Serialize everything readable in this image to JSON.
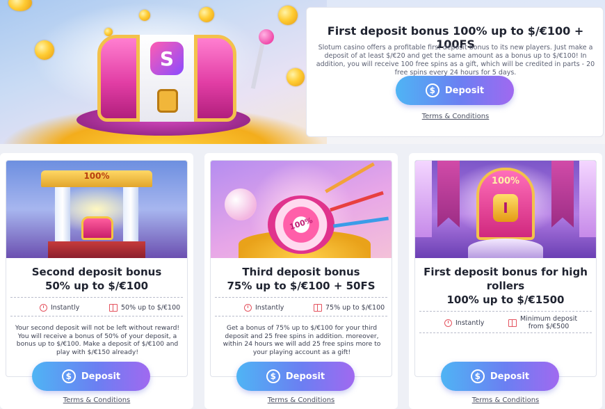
{
  "hero": {
    "title": "First deposit bonus 100% up to $/€100 + 100FS",
    "description": "Slotum casino offers a profitable first deposit bonus to its new players. Just make a deposit of at least $/€20 and get the same amount as a bonus up to $/€100! In addition, you will receive 100 free spins as a gift, which will be credited in parts - 20 free spins every 24 hours for 5 days.",
    "button_label": "Deposit",
    "terms_label": "Terms & Conditions"
  },
  "cards": [
    {
      "title_line1": "Second deposit bonus",
      "title_line2": "50% up to $/€100",
      "timing": "Instantly",
      "bonus": "50% up to $/€100",
      "description": "Your second deposit will not be left without reward! You will receive a bonus of 50% of your deposit, a bonus up to $/€100. Make a deposit of $/€100 and play with $/€150 already!",
      "button_label": "Deposit",
      "terms_label": "Terms & Conditions",
      "art_label": "100%"
    },
    {
      "title_line1": "Third deposit bonus",
      "title_line2": "75% up to $/€100 + 50FS",
      "timing": "Instantly",
      "bonus": "75% up to $/€100",
      "description": "Get a bonus of 75% up to $/€100 for your third deposit and 25 free spins in addition. moreover, within 24 hours we will add 25 free spins more to your playing account as a gift!",
      "button_label": "Deposit",
      "terms_label": "Terms & Conditions",
      "art_label": "100%"
    },
    {
      "title_line1": "First deposit bonus for high",
      "title_line2": "rollers",
      "title_line3": "100% up to $/€1500",
      "timing": "Instantly",
      "bonus_line1": "Minimum deposit",
      "bonus_line2": "from $/€500",
      "button_label": "Deposit",
      "terms_label": "Terms & Conditions",
      "art_label": "100%"
    }
  ],
  "icons": {
    "deposit": "dollar-coin-icon",
    "timing": "clock-icon",
    "bonus": "gift-icon"
  },
  "colors": {
    "button_gradient_start": "#4fb4f4",
    "button_gradient_end": "#a069f0",
    "accent_icon": "#e4525e",
    "title_text": "#1f2330"
  }
}
